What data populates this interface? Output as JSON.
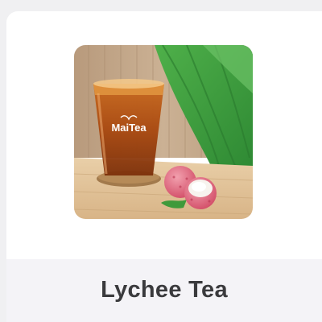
{
  "product": {
    "name": "Lychee Tea",
    "image_brand_text": "MaiTea",
    "image_alt": "Lychee Tea"
  },
  "colors": {
    "page_background": "#f0f0f2",
    "card_background": "#ffffff",
    "name_band": "#f4f3f7",
    "name_text": "#3a3a3d"
  }
}
